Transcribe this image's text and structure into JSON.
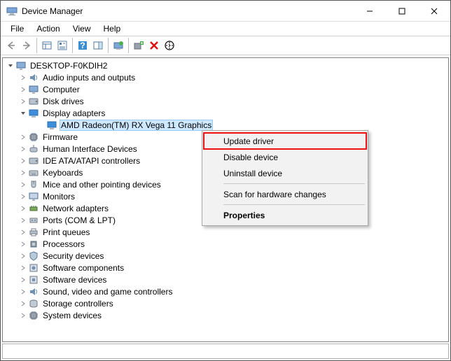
{
  "window": {
    "title": "Device Manager"
  },
  "menu": {
    "items": [
      "File",
      "Action",
      "View",
      "Help"
    ]
  },
  "toolbar": {
    "buttons": [
      "back",
      "forward",
      "show-hidden",
      "properties",
      "help",
      "refresh",
      "monitor-action",
      "add-legacy",
      "remove",
      "scan"
    ]
  },
  "tree": {
    "root": "DESKTOP-F0KDIH2",
    "categories": [
      {
        "label": "Audio inputs and outputs",
        "icon": "speaker"
      },
      {
        "label": "Computer",
        "icon": "pc"
      },
      {
        "label": "Disk drives",
        "icon": "disk"
      },
      {
        "label": "Display adapters",
        "icon": "display",
        "expanded": true,
        "children": [
          {
            "label": "AMD Radeon(TM) RX Vega 11 Graphics",
            "icon": "display",
            "selected": true
          }
        ]
      },
      {
        "label": "Firmware",
        "icon": "chip"
      },
      {
        "label": "Human Interface Devices",
        "icon": "hid"
      },
      {
        "label": "IDE ATA/ATAPI controllers",
        "icon": "disk"
      },
      {
        "label": "Keyboards",
        "icon": "keyboard"
      },
      {
        "label": "Mice and other pointing devices",
        "icon": "mouse"
      },
      {
        "label": "Monitors",
        "icon": "monitor"
      },
      {
        "label": "Network adapters",
        "icon": "net"
      },
      {
        "label": "Ports (COM & LPT)",
        "icon": "port"
      },
      {
        "label": "Print queues",
        "icon": "printer"
      },
      {
        "label": "Processors",
        "icon": "cpu"
      },
      {
        "label": "Security devices",
        "icon": "shield"
      },
      {
        "label": "Software components",
        "icon": "swc"
      },
      {
        "label": "Software devices",
        "icon": "swd"
      },
      {
        "label": "Sound, video and game controllers",
        "icon": "speaker"
      },
      {
        "label": "Storage controllers",
        "icon": "storage"
      },
      {
        "label": "System devices",
        "icon": "chip"
      }
    ]
  },
  "context_menu": {
    "items": [
      {
        "label": "Update driver",
        "highlight": true
      },
      {
        "label": "Disable device"
      },
      {
        "label": "Uninstall device"
      },
      {
        "sep": true
      },
      {
        "label": "Scan for hardware changes"
      },
      {
        "sep": true
      },
      {
        "label": "Properties",
        "bold": true
      }
    ]
  }
}
